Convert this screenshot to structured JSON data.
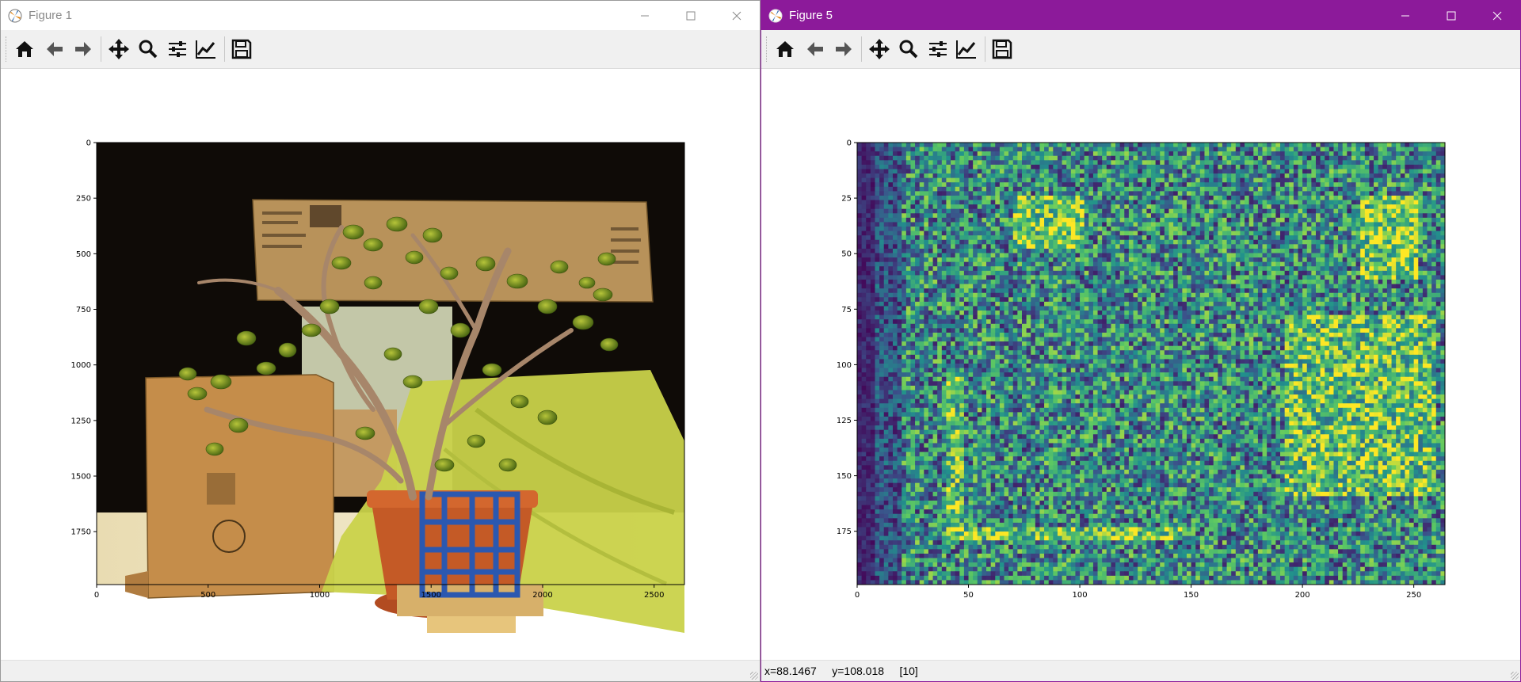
{
  "windows": [
    {
      "title": "Figure 1",
      "toolbar": [
        "home-icon",
        "back-arrow-icon",
        "forward-arrow-icon",
        "pan-move-icon",
        "zoom-magnifier-icon",
        "configure-subplots-icon",
        "edit-axes-curve-icon",
        "save-floppy-icon"
      ],
      "status_text": "",
      "plot": {
        "xticks": [
          "0",
          "500",
          "1000",
          "1500",
          "2000",
          "2500"
        ],
        "yticks": [
          "0",
          "250",
          "500",
          "750",
          "1000",
          "1250",
          "1500",
          "1750"
        ]
      }
    },
    {
      "title": "Figure 5",
      "toolbar": [
        "home-icon",
        "back-arrow-icon",
        "forward-arrow-icon",
        "pan-move-icon",
        "zoom-magnifier-icon",
        "configure-subplots-icon",
        "edit-axes-curve-icon",
        "save-floppy-icon"
      ],
      "status_text": "x=88.1467     y=108.018     [10]",
      "plot": {
        "xticks": [
          "0",
          "50",
          "100",
          "150",
          "200",
          "250"
        ],
        "yticks": [
          "0",
          "25",
          "50",
          "75",
          "100",
          "125",
          "150",
          "175"
        ]
      }
    }
  ],
  "colors": {
    "figure5_title_bar": "#8c1a9a",
    "viridis_low": "#440154",
    "viridis_mid": "#21918c",
    "viridis_high": "#fde725"
  }
}
